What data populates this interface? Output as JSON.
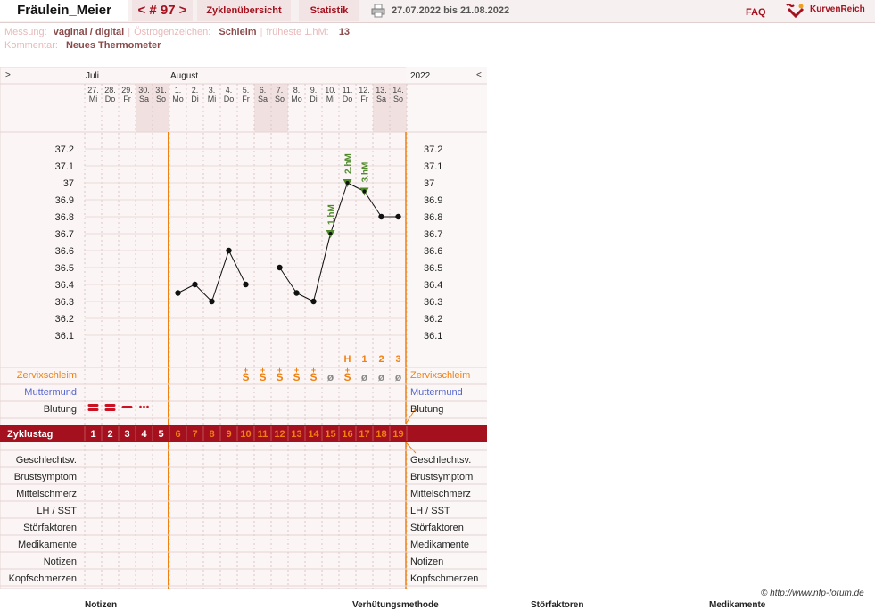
{
  "header": {
    "user_name": "Fräulein_Meier",
    "cycle_nav": "< # 97 >",
    "tab_overview": "Zyklenübersicht",
    "tab_stats": "Statistik",
    "date_range": "27.07.2022 bis 21.08.2022",
    "faq": "FAQ",
    "logo_text": "KurvenReich"
  },
  "info": {
    "messung_label": "Messung:",
    "messung_value": "vaginal / digital",
    "oestrogen_label": "Östrogenzeichen:",
    "oestrogen_value": "Schleim",
    "hm_label": "früheste 1.hM:",
    "hm_value": "13",
    "kommentar_label": "Kommentar:",
    "kommentar_value": "Neues Thermometer"
  },
  "nav": {
    "prev": ">",
    "next": "<"
  },
  "months": {
    "m1": "Juli",
    "m2": "August",
    "year": "2022"
  },
  "days": [
    {
      "num": "27.",
      "wd": "Mi",
      "we": false
    },
    {
      "num": "28.",
      "wd": "Do",
      "we": false
    },
    {
      "num": "29.",
      "wd": "Fr",
      "we": false
    },
    {
      "num": "30.",
      "wd": "Sa",
      "we": true
    },
    {
      "num": "31.",
      "wd": "So",
      "we": true
    },
    {
      "num": "1.",
      "wd": "Mo",
      "we": false
    },
    {
      "num": "2.",
      "wd": "Di",
      "we": false
    },
    {
      "num": "3.",
      "wd": "Mi",
      "we": false
    },
    {
      "num": "4.",
      "wd": "Do",
      "we": false
    },
    {
      "num": "5.",
      "wd": "Fr",
      "we": false
    },
    {
      "num": "6.",
      "wd": "Sa",
      "we": true
    },
    {
      "num": "7.",
      "wd": "So",
      "we": true
    },
    {
      "num": "8.",
      "wd": "Mo",
      "we": false
    },
    {
      "num": "9.",
      "wd": "Di",
      "we": false
    },
    {
      "num": "10.",
      "wd": "Mi",
      "we": false
    },
    {
      "num": "11.",
      "wd": "Do",
      "we": false
    },
    {
      "num": "12.",
      "wd": "Fr",
      "we": false
    },
    {
      "num": "13.",
      "wd": "Sa",
      "we": true
    },
    {
      "num": "14.",
      "wd": "So",
      "we": true
    }
  ],
  "chart_data": {
    "type": "line",
    "y_ticks": [
      "37.2",
      "37.1",
      "37",
      "36.9",
      "36.8",
      "36.7",
      "36.6",
      "36.5",
      "36.4",
      "36.3",
      "36.2",
      "36.1"
    ],
    "ylim": [
      36.0,
      37.3
    ],
    "temperatures": [
      null,
      null,
      null,
      null,
      null,
      36.35,
      36.4,
      36.3,
      36.6,
      36.4,
      null,
      36.5,
      36.35,
      36.3,
      36.7,
      37.0,
      36.95,
      36.8,
      36.8
    ],
    "markers": [
      {
        "day_index": 14,
        "label": "1.hM"
      },
      {
        "day_index": 15,
        "label": "2.hM"
      },
      {
        "day_index": 16,
        "label": "3.hM"
      }
    ],
    "grid": true
  },
  "rows": {
    "zervix": "Zervixschleim",
    "muttermund": "Muttermund",
    "blutung": "Blutung",
    "zyklustag": "Zyklustag",
    "bottom": [
      "Geschlechtsv.",
      "Brustsymptom",
      "Mittelschmerz",
      "LH / SST",
      "Störfaktoren",
      "Medikamente",
      "Notizen",
      "Kopfschmerzen"
    ]
  },
  "zervix_marks": [
    "",
    "",
    "",
    "",
    "",
    "",
    "",
    "",
    "",
    "S",
    "S",
    "S",
    "S",
    "S",
    "ø",
    "S",
    "ø",
    "ø",
    "ø"
  ],
  "zervix_plus": [
    false,
    false,
    false,
    false,
    false,
    false,
    false,
    false,
    false,
    true,
    true,
    true,
    true,
    true,
    false,
    true,
    false,
    false,
    false
  ],
  "peak_marks": [
    "",
    "",
    "",
    "",
    "",
    "",
    "",
    "",
    "",
    "",
    "",
    "",
    "",
    "",
    "",
    "H",
    "1",
    "2",
    "3"
  ],
  "bleeding": [
    "heavy",
    "heavy",
    "medium",
    "light",
    "",
    "",
    "",
    "",
    "",
    "",
    "",
    "",
    "",
    "",
    "",
    "",
    "",
    "",
    ""
  ],
  "cycle_days": [
    "1",
    "2",
    "3",
    "4",
    "5",
    "6",
    "7",
    "8",
    "9",
    "10",
    "11",
    "12",
    "13",
    "14",
    "15",
    "16",
    "17",
    "18",
    "19"
  ],
  "footer": {
    "copyright": "© http://www.nfp-forum.de",
    "col_notizen": "Notizen",
    "col_verhuetung": "Verhütungsmethode",
    "col_stoer": "Störfaktoren",
    "col_medi": "Medikamente"
  },
  "colors": {
    "accent": "#a4101e",
    "orange": "#f08010",
    "blue": "#5566cc",
    "marker_green": "#4f8a2a",
    "bleed": "#cc1122"
  }
}
